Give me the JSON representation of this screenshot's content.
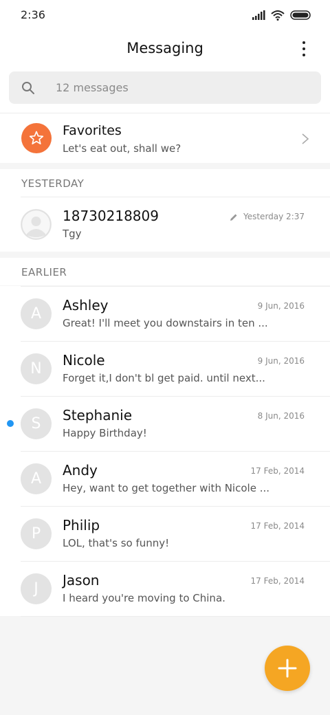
{
  "status_bar": {
    "time": "2:36"
  },
  "header": {
    "title": "Messaging"
  },
  "search": {
    "placeholder": "12 messages"
  },
  "favorites": {
    "name": "Favorites",
    "preview": "Let's eat out, shall we?",
    "icon": "star-icon",
    "color": "#f4733a"
  },
  "sections": {
    "yesterday": "YESTERDAY",
    "earlier": "EARLIER"
  },
  "yesterday_conversation": {
    "name": "18730218809",
    "preview": "Tgy",
    "date": "Yesterday 2:37",
    "draft": true
  },
  "conversations": [
    {
      "initial": "A",
      "name": "Ashley",
      "preview": "Great! I'll meet you downstairs in ten ...",
      "date": "9 Jun, 2016",
      "unread": false
    },
    {
      "initial": "N",
      "name": "Nicole",
      "preview": "Forget it,I don't bl get paid. until next...",
      "date": "9 Jun, 2016",
      "unread": false
    },
    {
      "initial": "S",
      "name": "Stephanie",
      "preview": "Happy Birthday!",
      "date": "8 Jun, 2016",
      "unread": true
    },
    {
      "initial": "A",
      "name": "Andy",
      "preview": "Hey, want to get together with Nicole ...",
      "date": "17 Feb, 2014",
      "unread": false
    },
    {
      "initial": "P",
      "name": "Philip",
      "preview": "LOL, that's so funny!",
      "date": "17 Feb, 2014",
      "unread": false
    },
    {
      "initial": "J",
      "name": "Jason",
      "preview": "I heard you're moving to China.",
      "date": "17 Feb, 2014",
      "unread": false
    }
  ],
  "fab": {
    "icon": "plus-icon",
    "color": "#f5a623"
  },
  "colors": {
    "unread": "#2196f3",
    "avatar_bg": "#e3e3e3"
  }
}
